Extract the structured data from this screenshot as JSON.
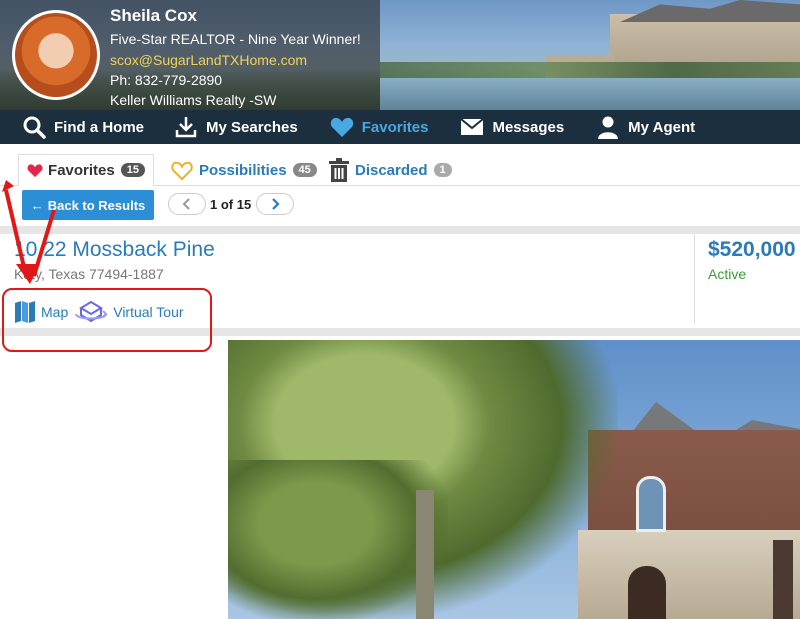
{
  "agent": {
    "name": "Sheila Cox",
    "title": "Five-Star REALTOR - Nine Year Winner!",
    "email": "scox@SugarLandTXHome.com",
    "phone": "Ph: 832-779-2890",
    "brokerage": "Keller Williams Realty -SW"
  },
  "nav": {
    "find_home": "Find a Home",
    "my_searches": "My Searches",
    "favorites": "Favorites",
    "messages": "Messages",
    "my_agent": "My Agent"
  },
  "tabs": {
    "favorites": {
      "label": "Favorites",
      "count": "15"
    },
    "possibilities": {
      "label": "Possibilities",
      "count": "45"
    },
    "discarded": {
      "label": "Discarded",
      "count": "1"
    }
  },
  "toolbar": {
    "back_label": "Back to Results",
    "pager_text": "1 of 15"
  },
  "listing": {
    "address": "10622 Mossback Pine",
    "address_visible": "10 22 Mossback Pine",
    "city_state": "Katy, Texas 77494-1887",
    "price": "$520,000",
    "status": "Active",
    "map_label": "Map",
    "virtual_tour_label": "Virtual Tour"
  },
  "colors": {
    "accent": "#2a7bb8",
    "nav_bg": "#1c2f3e",
    "active_nav": "#4aa8e0",
    "status_active": "#3a9b3a",
    "annotation": "#e01818"
  },
  "icons": {
    "nav": [
      "search-icon",
      "download-icon",
      "heart-icon",
      "envelope-icon",
      "user-icon"
    ],
    "tabs": [
      "heart-icon",
      "heart-outline-icon",
      "trash-icon"
    ],
    "links": [
      "map-icon",
      "virtual-tour-icon"
    ]
  }
}
